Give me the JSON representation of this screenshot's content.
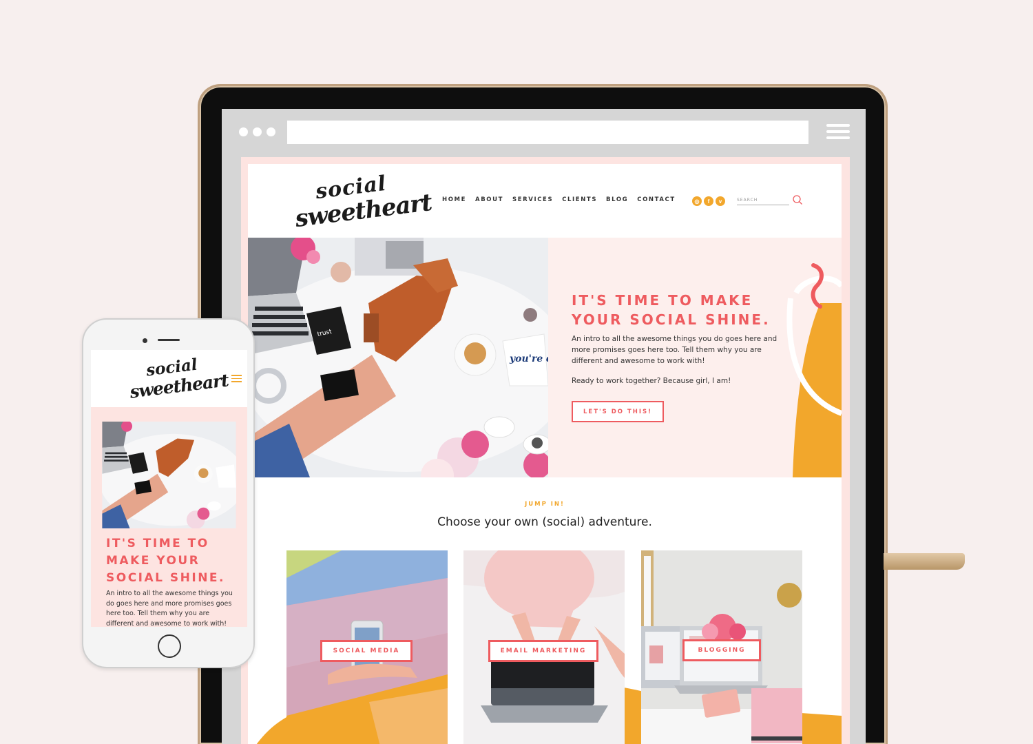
{
  "site": {
    "logo_line1": "social",
    "logo_line2": "sweetheart",
    "nav": [
      "HOME",
      "ABOUT",
      "SERVICES",
      "CLIENTS",
      "BLOG",
      "CONTACT"
    ],
    "social_icons": [
      "instagram-icon",
      "facebook-icon",
      "vimeo-icon"
    ],
    "search_placeholder": "SEARCH",
    "hero": {
      "title_line1": "IT'S TIME TO MAKE",
      "title_line2": "YOUR SOCIAL SHINE.",
      "body": "An intro to all the awesome things you do goes here and more promises goes here too. Tell them why you are different and awesome to work with!",
      "body2": "Ready to work together? Because girl, I am!",
      "cta": "LET'S DO THIS!"
    },
    "jump_label": "JUMP IN!",
    "section_heading": "Choose your own (social) adventure.",
    "cards": [
      "SOCIAL MEDIA",
      "EMAIL MARKETING",
      "BLOGGING"
    ],
    "photo_text": {
      "card_note": "you're dope."
    }
  },
  "mobile": {
    "logo_line1": "social",
    "logo_line2": "sweetheart",
    "title_line1": "IT'S TIME TO",
    "title_line2": "MAKE YOUR",
    "title_line3": "SOCIAL SHINE.",
    "body": "An intro to all the awesome things you do goes here and more promises goes here too. Tell them why you are different and awesome to work with!"
  },
  "colors": {
    "accent_coral": "#ee5b5f",
    "accent_orange": "#f2a72c",
    "blush": "#fde4e1"
  }
}
